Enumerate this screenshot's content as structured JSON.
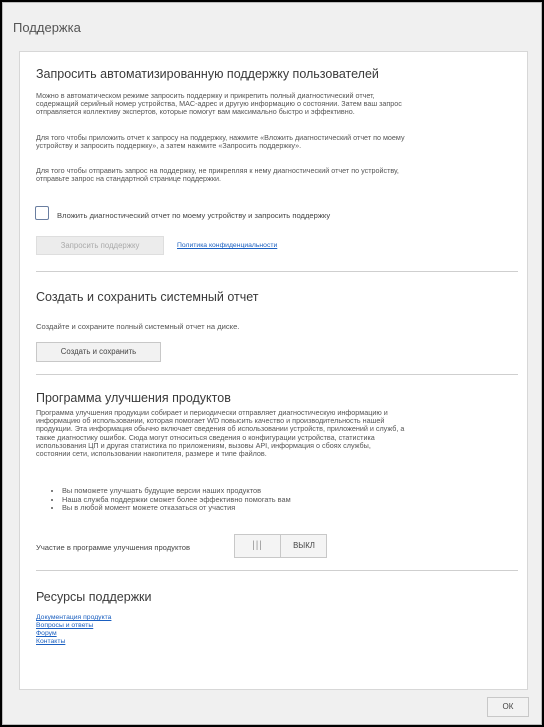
{
  "dialog": {
    "title": "Поддержка",
    "ok_label": "ОК"
  },
  "auto_support": {
    "title": "Запросить автоматизированную поддержку пользователей",
    "para1_lines": [
      "Можно в автоматическом режиме запросить поддержку и прикрепить полный диагностический отчет,",
      "содержащий серийный номер устройства, MAC-адрес и другую информацию о состоянии. Затем ваш запрос",
      "отправляется коллективу экспертов, которые помогут вам максимально быстро и эффективно."
    ],
    "para2_lines": [
      "Для того чтобы приложить отчет к запросу на поддержку, нажмите «Вложить диагностический отчет по моему",
      "устройству и запросить поддержку», а затем нажмите «Запросить поддержку»."
    ],
    "para3_lines": [
      "Для того чтобы отправить запрос на поддержку, не прикрепляя к нему диагностический отчет по устройству,",
      "отправьте запрос на стандартной странице поддержки."
    ],
    "checkbox_label": "Вложить диагностический отчет по моему устройству и запросить поддержку",
    "checkbox_checked": false,
    "request_button": "Запросить поддержку",
    "privacy_link": "Политика конфиденциальности"
  },
  "system_report": {
    "title": "Создать и сохранить системный отчет",
    "description": "Создайте и сохраните полный системный отчет на диске.",
    "button": "Создать и сохранить"
  },
  "improvement": {
    "title": "Программа улучшения продуктов",
    "para_lines": [
      "Программа улучшения продукции собирает и периодически отправляет диагностическую информацию и",
      "информацию об использовании, которая помогает WD повысить качество и производительность нашей",
      "продукции. Эта информация обычно включает сведения об использовании устройств, приложений и служб, а",
      "также диагностику ошибок. Сюда могут относиться сведения о конфигурации устройства, статистика",
      "использования ЦП и другая статистика по приложениям, вызовы API, информация о сбоях службы,",
      "состоянии сети, использовании накопителя, размере и типе файлов."
    ],
    "bullets": [
      "Вы поможете улучшать будущие версии наших продуктов",
      "Наша служба поддержки сможет более эффективно помогать вам",
      "Вы в любой момент можете отказаться от участия"
    ],
    "toggle_label": "Участие в программе улучшения продуктов",
    "toggle_state": "ВЫКЛ"
  },
  "resources": {
    "title": "Ресурсы поддержки",
    "links": [
      "Документация продукта",
      "Вопросы и ответы",
      "Форум",
      "Контакты"
    ]
  }
}
